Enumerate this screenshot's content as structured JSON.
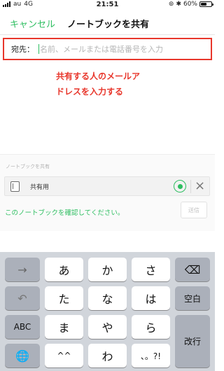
{
  "status_bar": {
    "carrier": "au",
    "network": "4G",
    "time": "21:51",
    "battery": "60%",
    "battery_level": 0.6
  },
  "nav": {
    "cancel_label": "キャンセル",
    "title": "ノートブックを共有"
  },
  "recipient": {
    "label": "宛先：",
    "placeholder": "名前、メールまたは電話番号を入力",
    "value": ""
  },
  "annotation": {
    "line1": "共有する人のメールア",
    "line2": "ドレスを入力する"
  },
  "share_section": {
    "label": "ノートブックを共有",
    "notebook_name": "共有用",
    "remove_symbol": "×",
    "confirm_text": "このノートブックを確認してください。",
    "send_label": "送信"
  },
  "keyboard": {
    "rows": [
      [
        "→",
        "あ",
        "か",
        "さ",
        "⌫"
      ],
      [
        "↶",
        "た",
        "な",
        "は",
        "空白"
      ],
      [
        "ABC",
        "ま",
        "や",
        "ら",
        "改行"
      ],
      [
        "🌐",
        "^^",
        "わ",
        "、。?!",
        ""
      ]
    ],
    "icons": {
      "arrow": "right-arrow-icon",
      "delete": "delete-icon",
      "undo": "undo-icon",
      "globe": "globe-icon"
    }
  },
  "colors": {
    "accent_green": "#2dbe60",
    "annotation_red": "#e8362b",
    "keyboard_bg": "#d1d5db",
    "dark_key": "#abb0ba"
  }
}
